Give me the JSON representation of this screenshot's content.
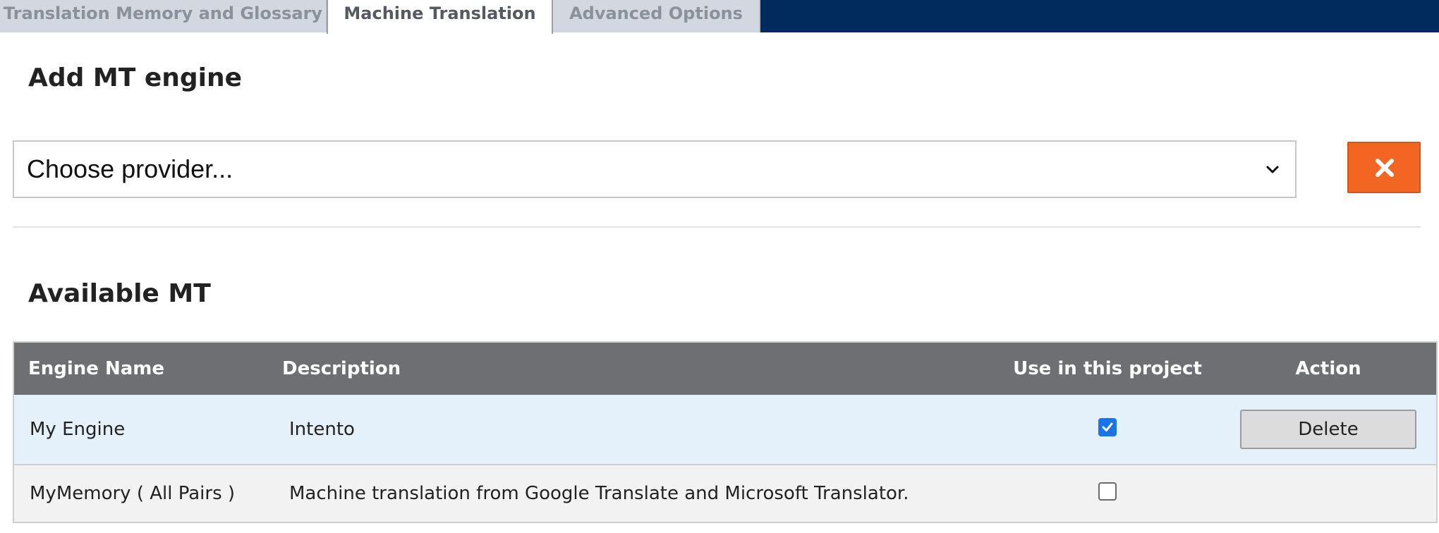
{
  "tabs": [
    {
      "label": "Translation Memory and Glossary",
      "active": false
    },
    {
      "label": "Machine Translation",
      "active": true
    },
    {
      "label": "Advanced Options",
      "active": false
    }
  ],
  "add_engine": {
    "title": "Add MT engine",
    "provider_select": {
      "value": "Choose provider..."
    },
    "close_icon": "close-icon"
  },
  "available": {
    "title": "Available MT",
    "columns": {
      "name": "Engine Name",
      "description": "Description",
      "use": "Use in this project",
      "action": "Action"
    },
    "rows": [
      {
        "name": "My Engine",
        "description": "Intento",
        "use": true,
        "action": "Delete"
      },
      {
        "name": "MyMemory ( All Pairs )",
        "description": "Machine translation from Google Translate and Microsoft Translator.",
        "use": false,
        "action": ""
      }
    ]
  },
  "colors": {
    "tabbar": "#002b5c",
    "accent_orange": "#f26522",
    "header_gray": "#6e6f72",
    "checkbox_blue": "#1a73e8"
  }
}
